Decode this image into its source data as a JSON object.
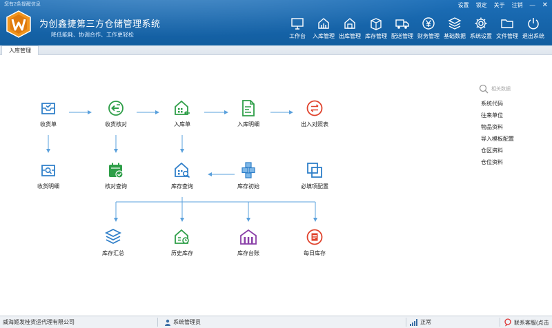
{
  "header": {
    "notification": "您有2条提醒信息",
    "title": "为创鑫捷第三方仓储管理系统",
    "slogan": "降低能耗、协调合作、工作更轻松",
    "links": {
      "settings": "设置",
      "lock": "锁定",
      "about": "关于",
      "logout": "注销"
    },
    "nav": [
      "工作台",
      "入库管理",
      "出库管理",
      "库存管理",
      "配送管理",
      "财务管理",
      "基础数据",
      "系统设置",
      "文件管理",
      "退出系统"
    ],
    "colors": {
      "primary": "#1766ac",
      "flow_blue": "#3d8fd8",
      "flow_green": "#2e9e48",
      "flow_red": "#e0432d",
      "flow_purple": "#8a3fa8"
    }
  },
  "tabs": {
    "active": "入库管理"
  },
  "flow": {
    "receipt": "收货单",
    "check": "收货核对",
    "inbound": "入库单",
    "inbound_detail": "入库明细",
    "io_compare": "出入对照表",
    "receipt_detail": "收货明细",
    "check_query": "核对查询",
    "stock_query": "库存查询",
    "stock_init": "库存初始",
    "required_config": "必填项配置",
    "stock_summary": "库存汇总",
    "history_stock": "历史库存",
    "stock_ledger": "库存台账",
    "daily_stock": "每日库存"
  },
  "side": {
    "search_placeholder": "相关数据",
    "items": [
      "系统代码",
      "往来单位",
      "物品资料",
      "导入模板配置",
      "仓区资料",
      "仓位资料"
    ]
  },
  "status": {
    "company": "威海姬发桂货运代理有限公司",
    "user": "系统管理员",
    "state": "正常",
    "support": "联系客服(点击"
  }
}
